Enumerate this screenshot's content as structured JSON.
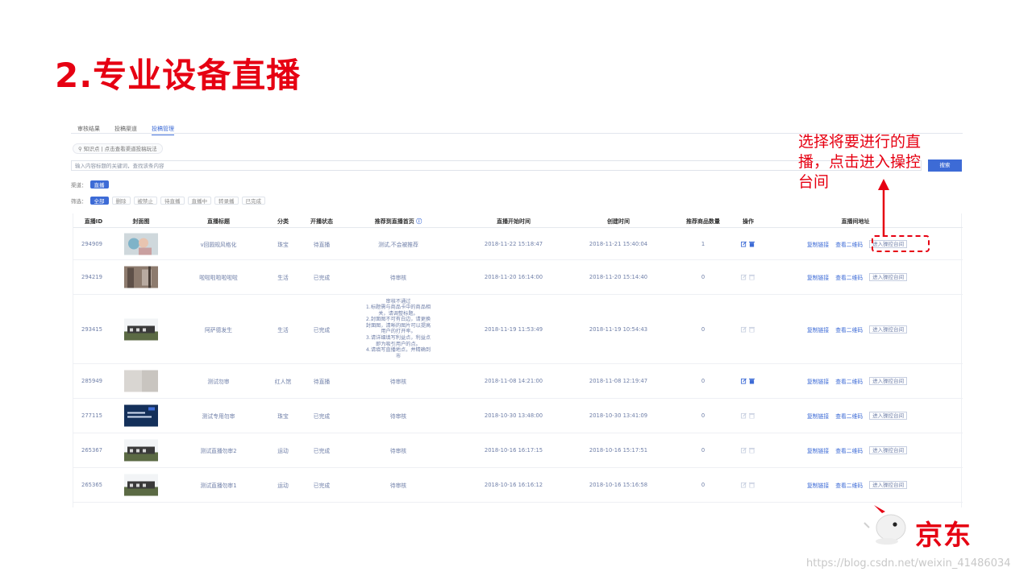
{
  "slide": {
    "title": "2.专业设备直播"
  },
  "tabs": [
    "审核结果",
    "投稿渠道",
    "投稿管理"
  ],
  "tip": "知识点 | 点击查看渠道投稿玩法",
  "search": {
    "placeholder": "输入内容标题的关键词，查找该条内容",
    "button": "搜索"
  },
  "channel": {
    "label": "渠道：",
    "value": "直播"
  },
  "filter": {
    "label": "筛选：",
    "options": [
      "全部",
      "删除",
      "被禁止",
      "待直播",
      "直播中",
      "转录播",
      "已完成"
    ],
    "selected": "全部"
  },
  "table": {
    "headers": [
      "直播ID",
      "封面图",
      "直播标题",
      "分类",
      "开播状态",
      "推荐到直播首页",
      "直播开始时间",
      "创建时间",
      "推荐商品数量",
      "操作",
      "直播间地址"
    ],
    "rows": [
      {
        "id": "294909",
        "title": "v回圆规风格化",
        "category": "珠宝",
        "status": "待直播",
        "recommend": "测试,不会被推荐",
        "start": "2018-11-22 15:18:47",
        "created": "2018-11-21 15:40:04",
        "count": "1",
        "ops_active": true
      },
      {
        "id": "294219",
        "title": "啦啦啦啦啦啦啦",
        "category": "生活",
        "status": "已完成",
        "recommend": "待审核",
        "start": "2018-11-20 16:14:00",
        "created": "2018-11-20 15:14:40",
        "count": "0",
        "ops_active": false
      },
      {
        "id": "293415",
        "title": "阿萨德发生",
        "category": "生活",
        "status": "已完成",
        "recommend": "审核不通过\n1.标题需与商品卡中的商品相关，请调整标题。\n2.封面图不可有白边，请更换封面图，清晰的图片可以提高用户的打开率。\n3.请详细填写利益点，利益点即为吸引用户的点。\n4.请填写直播地点，并精确到市",
        "start": "2018-11-19 11:53:49",
        "created": "2018-11-19 10:54:43",
        "count": "0",
        "ops_active": false
      },
      {
        "id": "285949",
        "title": "测试勿审",
        "category": "红人馆",
        "status": "待直播",
        "recommend": "待审核",
        "start": "2018-11-08 14:21:00",
        "created": "2018-11-08 12:19:47",
        "count": "0",
        "ops_active": true
      },
      {
        "id": "277115",
        "title": "测试专用勿审",
        "category": "珠宝",
        "status": "已完成",
        "recommend": "待审核",
        "start": "2018-10-30 13:48:00",
        "created": "2018-10-30 13:41:09",
        "count": "0",
        "ops_active": false
      },
      {
        "id": "265367",
        "title": "测试直播勿审2",
        "category": "运动",
        "status": "已完成",
        "recommend": "待审核",
        "start": "2018-10-16 16:17:15",
        "created": "2018-10-16 15:17:51",
        "count": "0",
        "ops_active": false
      },
      {
        "id": "265365",
        "title": "测试直播勿审1",
        "category": "运动",
        "status": "已完成",
        "recommend": "待审核",
        "start": "2018-10-16 16:16:12",
        "created": "2018-10-16 15:16:58",
        "count": "0",
        "ops_active": false
      }
    ],
    "links": {
      "copy": "复制链接",
      "qrcode": "查看二维码",
      "enter": "进入操控台间"
    }
  },
  "annotation": {
    "text": "选择将要进行的直播，点击进入操控台间"
  },
  "logo": {
    "text": "京东"
  },
  "watermark": "https://blog.csdn.net/weixin_41486034",
  "colors": {
    "accent": "#e60012",
    "primary": "#3d6bd6"
  }
}
